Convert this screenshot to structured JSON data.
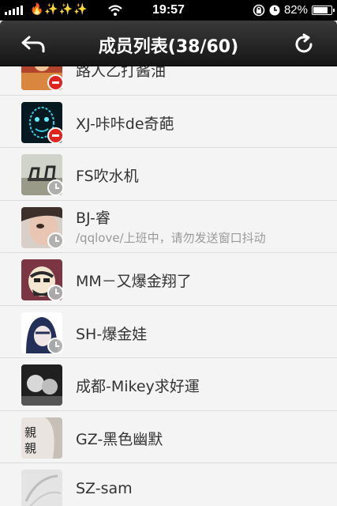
{
  "status_bar": {
    "emojis": "🔥✨✨✨",
    "time": "19:57",
    "battery": "82%",
    "battery_fraction": 0.82,
    "icons": [
      "signal-icon",
      "wifi-icon",
      "orientation-lock-icon",
      "alarm-icon",
      "battery-icon"
    ]
  },
  "nav": {
    "title": "成员列表(38/60)",
    "back_icon": "back-arrow-icon",
    "refresh_icon": "refresh-icon"
  },
  "members": [
    {
      "name": "路人乙打酱油",
      "status": "",
      "badge": "remove",
      "avatar": "red-scene"
    },
    {
      "name": "XJ-咔咔de奇葩",
      "status": "",
      "badge": "remove",
      "avatar": "cyan-face"
    },
    {
      "name": "FS吹水机",
      "status": "",
      "badge": "clock",
      "avatar": "chairs"
    },
    {
      "name": "BJ-睿",
      "status": "/qqlove/上班中，请勿发送窗口抖动",
      "badge": "clock",
      "avatar": "face-photo"
    },
    {
      "name": "MM－又爆金翔了",
      "status": "",
      "badge": "clock",
      "avatar": "cartoon-man"
    },
    {
      "name": "SH-爆金娃",
      "status": "",
      "badge": "clock",
      "avatar": "hooded"
    },
    {
      "name": "成都-Mikey求好運",
      "status": "",
      "badge": "none",
      "avatar": "bw-photo"
    },
    {
      "name": "GZ-黑色幽默",
      "status": "",
      "badge": "none",
      "avatar": "qinqin"
    },
    {
      "name": "SZ-sam",
      "status": "",
      "badge": "none",
      "avatar": "sketch"
    }
  ],
  "avatar_text": {
    "qinqin": "親親"
  }
}
